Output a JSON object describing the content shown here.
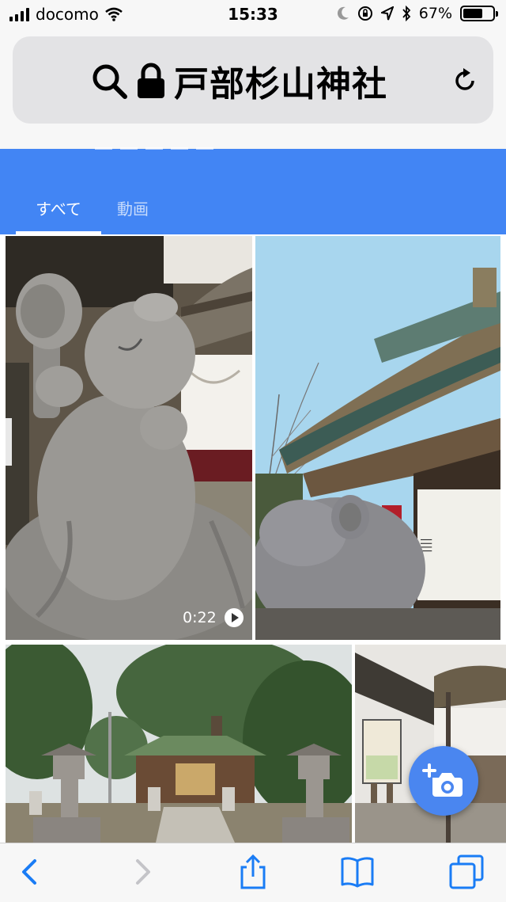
{
  "status_bar": {
    "carrier": "docomo",
    "time": "15:33",
    "battery": "67%",
    "battery_level": 0.67
  },
  "address_bar": {
    "title": "戸部杉山神社",
    "icons": [
      "search-icon",
      "lock-icon",
      "reload-icon"
    ]
  },
  "tabs": {
    "items": [
      {
        "label": "すべて",
        "active": true
      },
      {
        "label": "動画",
        "active": false
      }
    ]
  },
  "grid": {
    "video_duration": "0:22"
  },
  "fab": {
    "icon": "add-photo-icon"
  },
  "toolbar": {
    "icons": [
      "back-icon",
      "forward-icon",
      "share-icon",
      "bookmarks-icon",
      "tabs-icon"
    ]
  },
  "colors": {
    "accent": "#4285f4",
    "ios_blue": "#1a7cf5"
  }
}
